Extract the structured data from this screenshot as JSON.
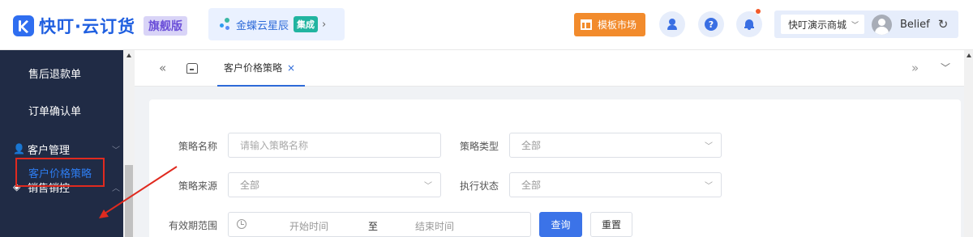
{
  "header": {
    "logo_text": "快叮·云订货",
    "edition_badge": "旗舰版",
    "partner": {
      "name": "金蝶云星辰",
      "tag": "集成",
      "arrow": "›"
    },
    "template_market": "模板市场",
    "shop_select": "快叮演示商城",
    "user_name": "Belief",
    "icons": [
      "kuaiding-logo-icon",
      "kingdee-icon",
      "template-icon",
      "customer-service-icon",
      "help-icon",
      "bell-icon",
      "avatar-icon",
      "refresh-icon"
    ]
  },
  "sidebar": {
    "items": [
      {
        "label": "售后退款单"
      },
      {
        "label": "订单确认单"
      },
      {
        "label": "客户管理"
      },
      {
        "label": "销售销控"
      },
      {
        "label": "客户价格策略"
      }
    ]
  },
  "tabs": {
    "active": "客户价格策略",
    "close": "×"
  },
  "filters": {
    "strategy_name_label": "策略名称",
    "strategy_name_placeholder": "请输入策略名称",
    "strategy_type_label": "策略类型",
    "strategy_type_value": "全部",
    "strategy_source_label": "策略来源",
    "strategy_source_value": "全部",
    "exec_status_label": "执行状态",
    "exec_status_value": "全部",
    "valid_range_label": "有效期范围",
    "start_placeholder": "开始时间",
    "range_separator": "至",
    "end_placeholder": "结束时间"
  },
  "buttons": {
    "query": "查询",
    "reset": "重置"
  },
  "colors": {
    "brand": "#2f6ef0",
    "sidebar_bg": "#202b45",
    "highlight_box": "#e02a1f",
    "template_btn": "#f28b2c",
    "primary_btn": "#3b73e8"
  }
}
